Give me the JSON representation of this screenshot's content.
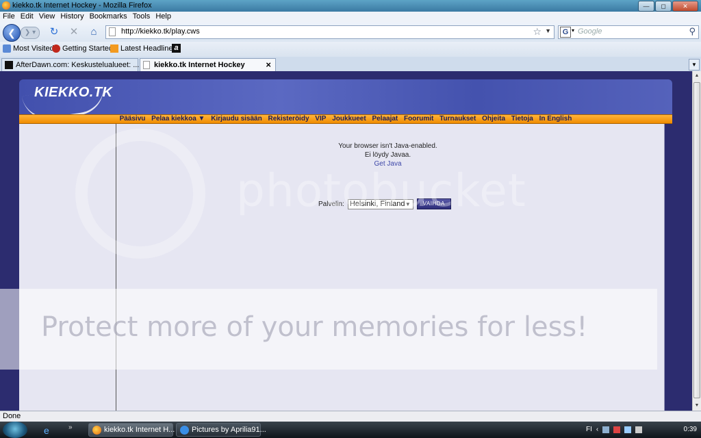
{
  "window": {
    "title": "kiekko.tk Internet Hockey - Mozilla Firefox"
  },
  "menu": [
    "File",
    "Edit",
    "View",
    "History",
    "Bookmarks",
    "Tools",
    "Help"
  ],
  "nav": {
    "url": "http://kiekko.tk/play.cws",
    "search_placeholder": "Google"
  },
  "bookmarks": [
    "Most Visited",
    "Getting Started",
    "Latest Headlines"
  ],
  "tabs": [
    {
      "label": "AfterDawn.com: Keskustelualueet: ...",
      "active": false
    },
    {
      "label": "kiekko.tk Internet Hockey",
      "active": true
    }
  ],
  "site": {
    "logo": "KIEKKO.TK",
    "nav": [
      "Pääsivu",
      "Pelaa kiekkoa ▼",
      "Kirjaudu sisään",
      "Rekisteröidy",
      "VIP",
      "Joukkueet",
      "Pelaajat",
      "Foorumit",
      "Turnaukset",
      "Ohjeita",
      "Tietoja",
      "In English"
    ],
    "msg1": "Your browser isn't Java-enabled.",
    "msg2": "Ei löydy Javaa.",
    "get_java": "Get Java",
    "server_label": "Palvelin:",
    "server_value": "Helsinki, Finland",
    "change_button": "VAIHDA"
  },
  "watermark": {
    "brand": "photobucket",
    "slogan": "Protect more of your memories for less!"
  },
  "status": "Done",
  "taskbar": {
    "items": [
      {
        "label": "kiekko.tk Internet H...",
        "active": true
      },
      {
        "label": "Pictures by Aprilia91...",
        "active": false
      }
    ],
    "lang": "FI",
    "time": "0:39"
  },
  "colors": {
    "accent_orange": "#f29a1a",
    "banner_blue": "#4a58b5",
    "page_bg": "#2c2c6f"
  }
}
